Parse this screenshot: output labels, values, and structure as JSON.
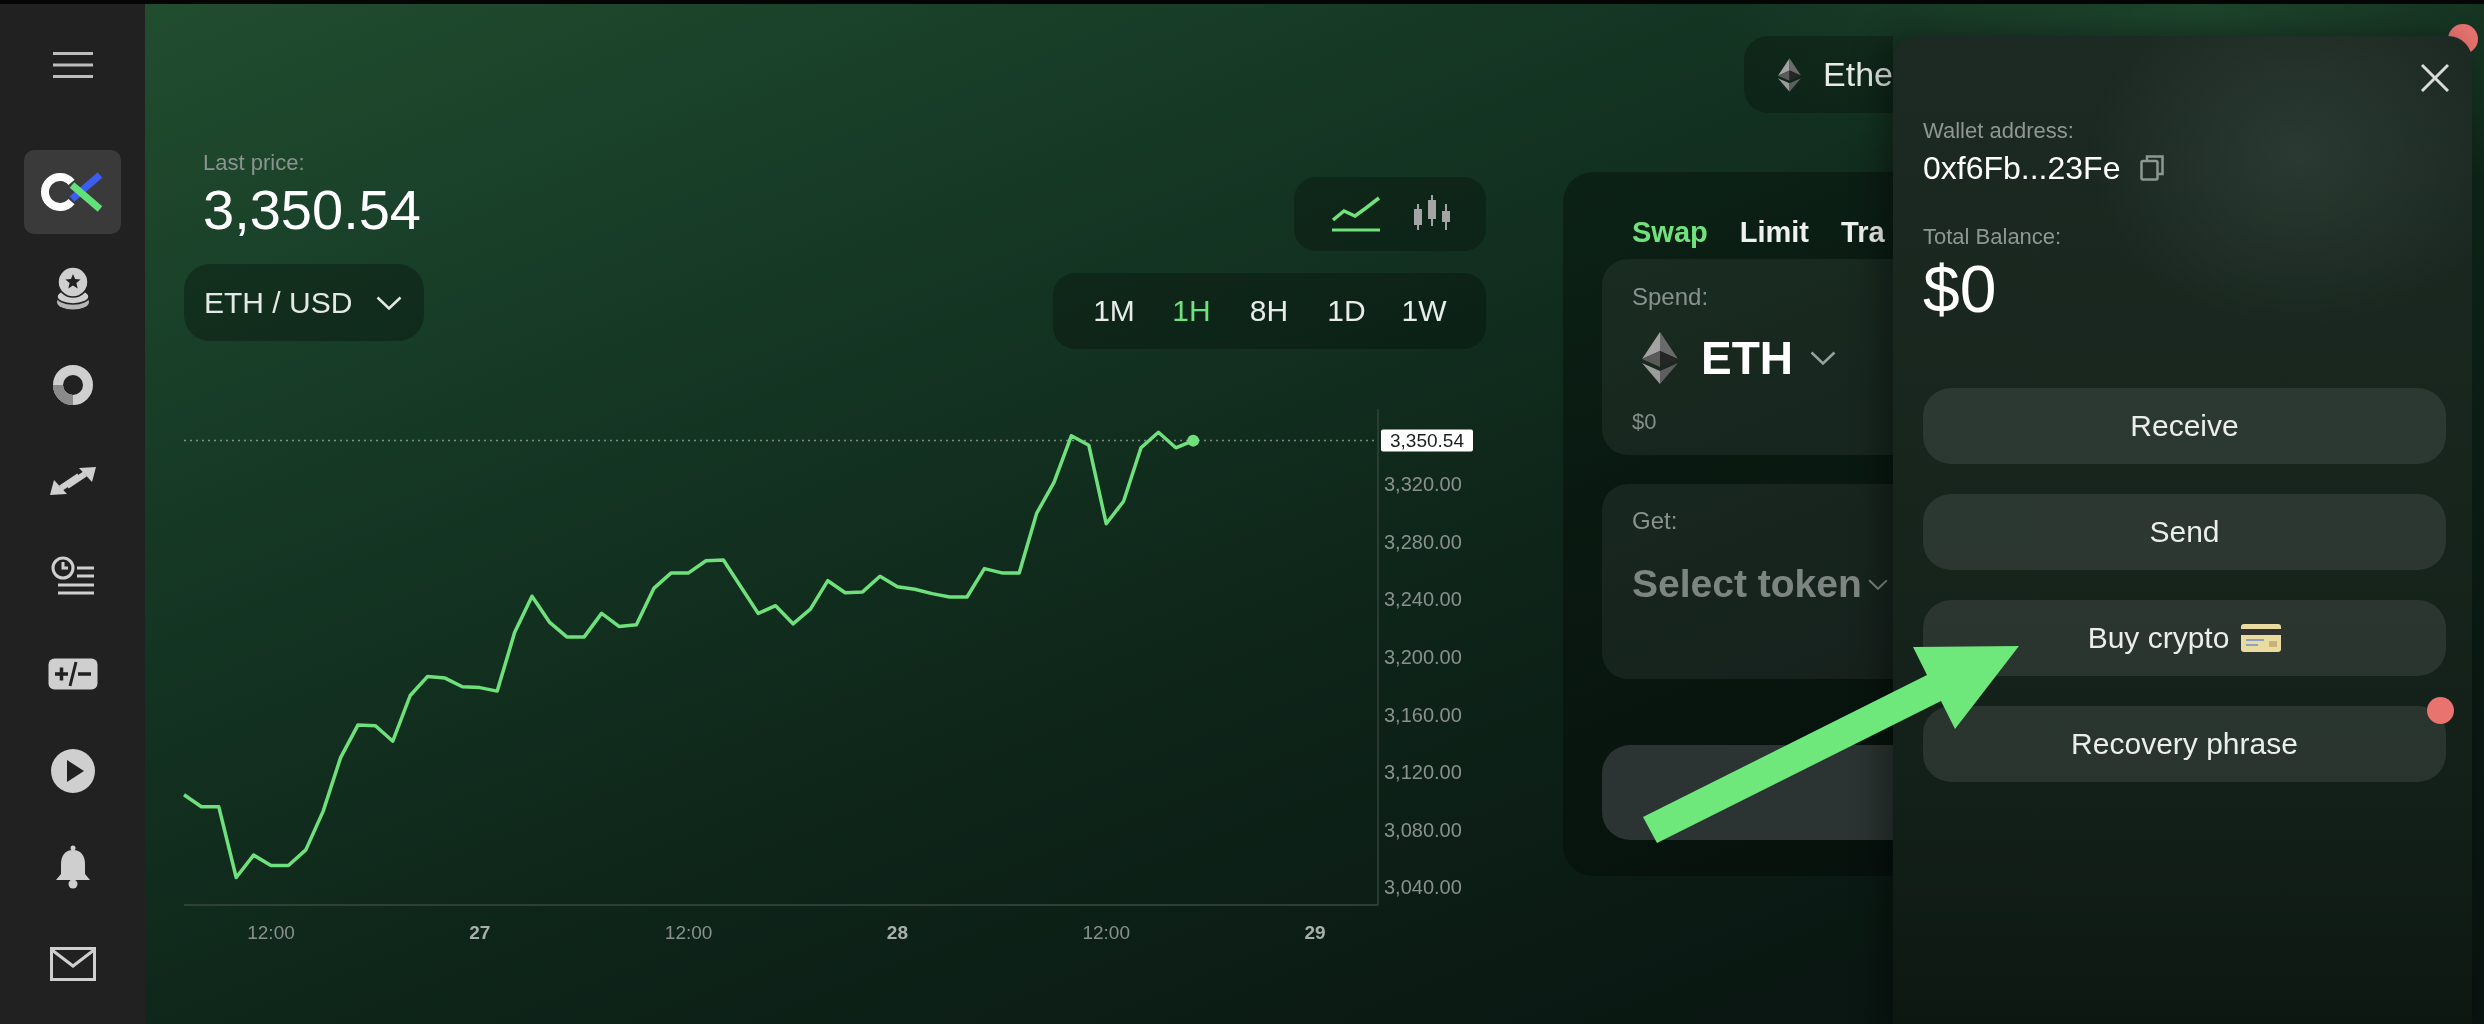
{
  "sidebar": {
    "items": [
      {
        "selected": true
      },
      {
        "selected": false
      },
      {
        "selected": false
      },
      {
        "selected": false
      },
      {
        "selected": false
      },
      {
        "selected": false
      },
      {
        "selected": false
      },
      {
        "selected": false
      },
      {
        "selected": false
      }
    ]
  },
  "price": {
    "label": "Last price:",
    "value": "3,350.54"
  },
  "pair_selector": {
    "label": "ETH / USD"
  },
  "chart_types": [
    {
      "selected": true
    },
    {
      "selected": false
    }
  ],
  "timeframes": [
    {
      "label": "1M",
      "selected": false
    },
    {
      "label": "1H",
      "selected": true
    },
    {
      "label": "8H",
      "selected": false
    },
    {
      "label": "1D",
      "selected": false
    },
    {
      "label": "1W",
      "selected": false
    }
  ],
  "chart": {
    "chart_data": {
      "type": "line",
      "categories": [
        null,
        null,
        null,
        null,
        null,
        "12:00",
        null,
        null,
        null,
        null,
        null,
        null,
        null,
        null,
        null,
        null,
        null,
        "27",
        null,
        null,
        null,
        null,
        null,
        null,
        null,
        null,
        null,
        null,
        null,
        "12:00",
        null,
        null,
        null,
        null,
        null,
        null,
        null,
        null,
        null,
        null,
        null,
        "28",
        null,
        null,
        null,
        null,
        null,
        null,
        null,
        null,
        null,
        null,
        null,
        "12:00",
        null,
        null,
        null,
        null,
        null,
        null,
        null,
        null,
        null,
        null,
        null,
        "29",
        null,
        null,
        null
      ],
      "series": [
        {
          "color": "#6ee07c",
          "values": [
            3104.2,
            3095.8,
            3095.8,
            3046.6,
            3062.2,
            3055.0,
            3055.0,
            3065.8,
            3092.8,
            3130.0,
            3152.8,
            3152.2,
            3141.4,
            3173.2,
            3186.5,
            3185.3,
            3179.3,
            3178.7,
            3176.3,
            3217.0,
            3242.3,
            3224.3,
            3214.0,
            3214.0,
            3230.3,
            3221.3,
            3222.5,
            3247.7,
            3258.5,
            3258.5,
            3266.9,
            3267.5,
            3248.9,
            3230.3,
            3235.7,
            3223.1,
            3233.3,
            3253.1,
            3244.7,
            3245.3,
            3256.1,
            3248.9,
            3247.1,
            3244.1,
            3241.7,
            3241.7,
            3261.5,
            3258.5,
            3258.5,
            3299.9,
            3321.5,
            3353.9,
            3347.3,
            3292.7,
            3308.3,
            3345.5,
            3356.3,
            3345.5,
            3350.5,
            null,
            null,
            null,
            null,
            null,
            null,
            null,
            null,
            null,
            null
          ]
        }
      ],
      "ylim": [
        3027.5,
        3372.5
      ],
      "yticks": [
        {
          "value": 3040,
          "label": "3,040.00"
        },
        {
          "value": 3080,
          "label": "3,080.00"
        },
        {
          "value": 3120,
          "label": "3,120.00"
        },
        {
          "value": 3160,
          "label": "3,160.00"
        },
        {
          "value": 3200,
          "label": "3,200.00"
        },
        {
          "value": 3240,
          "label": "3,240.00"
        },
        {
          "value": 3280,
          "label": "3,280.00"
        },
        {
          "value": 3320,
          "label": "3,320.00"
        }
      ],
      "ref_lines": [
        {
          "axis": "y",
          "value": 3350.54,
          "label": "3,350.54"
        }
      ]
    }
  },
  "network_selector": {
    "label": "Ethe"
  },
  "swap": {
    "tabs": [
      {
        "label": "Swap",
        "selected": true
      },
      {
        "label": "Limit",
        "selected": false
      },
      {
        "label": "Tra",
        "selected": false
      }
    ],
    "spend": {
      "label": "Spend:",
      "token": "ETH",
      "value": "$0"
    },
    "get": {
      "label": "Get:",
      "placeholder": "Select token"
    }
  },
  "wallet_panel": {
    "address_label": "Wallet address:",
    "address": "0xf6Fb...23Fe",
    "balance_label": "Total Balance:",
    "balance": "$0",
    "buttons": [
      {
        "label": "Receive",
        "kind": "plain",
        "notification": false
      },
      {
        "label": "Send",
        "kind": "plain",
        "notification": false
      },
      {
        "label": "Buy crypto",
        "kind": "card",
        "notification": false
      },
      {
        "label": "Recovery phrase",
        "kind": "plain",
        "notification": true
      }
    ]
  },
  "corner_notification": true
}
